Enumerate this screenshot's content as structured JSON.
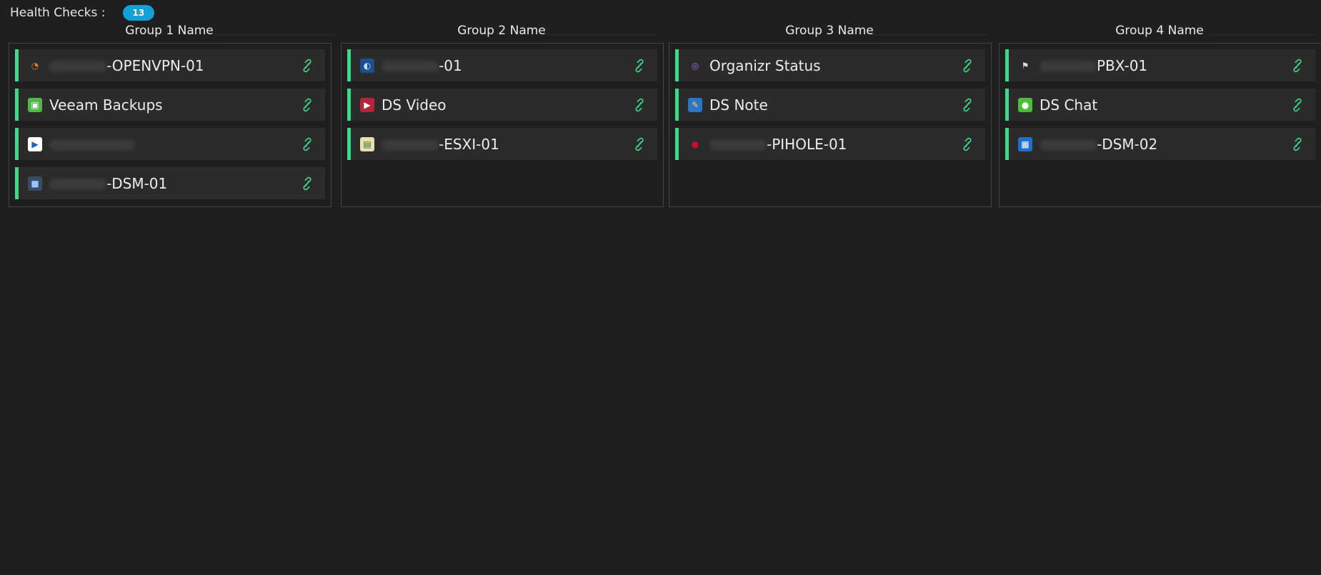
{
  "header": {
    "label": "Health Checks :",
    "count": "13"
  },
  "colors": {
    "status_ok": "#3fd98a",
    "badge": "#12a0d6"
  },
  "groups": [
    {
      "title": "Group 1 Name",
      "items": [
        {
          "label": "-OPENVPN-01",
          "icon": "openvpn-icon",
          "redacted": true
        },
        {
          "label": "Veeam Backups",
          "icon": "veeam-icon",
          "redacted": false
        },
        {
          "label": "",
          "icon": "app-icon",
          "redacted": true
        },
        {
          "label": "-DSM-01",
          "icon": "nas-icon",
          "redacted": true
        }
      ]
    },
    {
      "title": "Group 2 Name",
      "items": [
        {
          "label": "-01",
          "icon": "globe-icon",
          "redacted": true
        },
        {
          "label": "DS Video",
          "icon": "ds-video-icon",
          "redacted": false
        },
        {
          "label": "-ESXI-01",
          "icon": "esxi-icon",
          "redacted": true
        }
      ]
    },
    {
      "title": "Group 3 Name",
      "items": [
        {
          "label": "Organizr Status",
          "icon": "organizr-icon",
          "redacted": false
        },
        {
          "label": "DS Note",
          "icon": "ds-note-icon",
          "redacted": false
        },
        {
          "label": "-PIHOLE-01",
          "icon": "pihole-icon",
          "redacted": true
        }
      ]
    },
    {
      "title": "Group 4 Name",
      "items": [
        {
          "label": "PBX-01",
          "icon": "pbx-icon",
          "redacted": true
        },
        {
          "label": "DS Chat",
          "icon": "ds-chat-icon",
          "redacted": false
        },
        {
          "label": "-DSM-02",
          "icon": "dsm-icon",
          "redacted": true
        }
      ]
    }
  ]
}
